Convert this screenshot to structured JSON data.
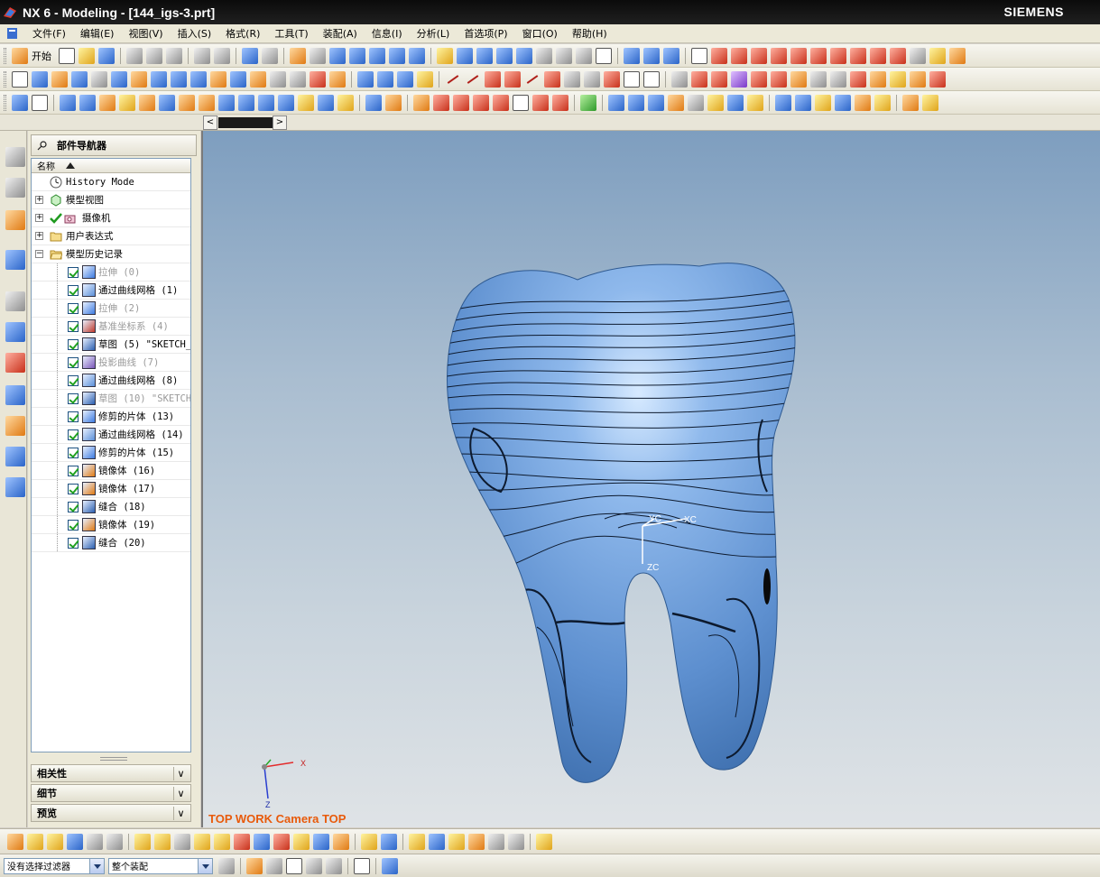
{
  "window": {
    "title": "NX 6 - Modeling - [144_igs-3.prt]",
    "brand": "SIEMENS"
  },
  "menu": [
    {
      "label": "文件(F)"
    },
    {
      "label": "编辑(E)"
    },
    {
      "label": "视图(V)"
    },
    {
      "label": "插入(S)"
    },
    {
      "label": "格式(R)"
    },
    {
      "label": "工具(T)"
    },
    {
      "label": "装配(A)"
    },
    {
      "label": "信息(I)"
    },
    {
      "label": "分析(L)"
    },
    {
      "label": "首选项(P)"
    },
    {
      "label": "窗口(O)"
    },
    {
      "label": "帮助(H)"
    }
  ],
  "toolbar": {
    "start_label": "开始"
  },
  "navigator": {
    "title": "部件导航器",
    "column_name": "名称",
    "top_nodes": [
      {
        "label": "History Mode"
      },
      {
        "label": "模型视图"
      },
      {
        "label": "摄像机"
      },
      {
        "label": "用户表达式"
      },
      {
        "label": "模型历史记录"
      }
    ],
    "features": [
      {
        "label": "拉伸 (0)",
        "dim": true
      },
      {
        "label": "通过曲线网格 (1)",
        "dim": false
      },
      {
        "label": "拉伸 (2)",
        "dim": true
      },
      {
        "label": "基准坐标系 (4)",
        "dim": true
      },
      {
        "label": "草图 (5) \"SKETCH_",
        "dim": false
      },
      {
        "label": "投影曲线 (7)",
        "dim": true
      },
      {
        "label": "通过曲线网格 (8)",
        "dim": false
      },
      {
        "label": "草图 (10) \"SKETCH",
        "dim": true
      },
      {
        "label": "修剪的片体 (13)",
        "dim": false
      },
      {
        "label": "通过曲线网格 (14)",
        "dim": false
      },
      {
        "label": "修剪的片体 (15)",
        "dim": false
      },
      {
        "label": "镜像体 (16)",
        "dim": false
      },
      {
        "label": "镜像体 (17)",
        "dim": false
      },
      {
        "label": "缝合 (18)",
        "dim": false
      },
      {
        "label": "镜像体 (19)",
        "dim": false
      },
      {
        "label": "缝合 (20)",
        "dim": false
      }
    ],
    "panels": [
      {
        "label": "相关性"
      },
      {
        "label": "细节"
      },
      {
        "label": "预览"
      }
    ]
  },
  "viewport": {
    "view_label": "TOP WORK Camera TOP",
    "triad": {
      "xc": "XC",
      "yc": "YC",
      "zc": "ZC"
    },
    "mini_triad": {
      "x": "X",
      "z": "Z"
    }
  },
  "status": {
    "filter_value": "没有选择过滤器",
    "scope_value": "整个装配"
  },
  "colors": {
    "titlebar": "#0b0b0b",
    "viewport_top": "#7e9ebf",
    "viewport_bottom": "#dfe3e6",
    "model": "#6f9fd8",
    "view_label": "#e85a0b"
  }
}
